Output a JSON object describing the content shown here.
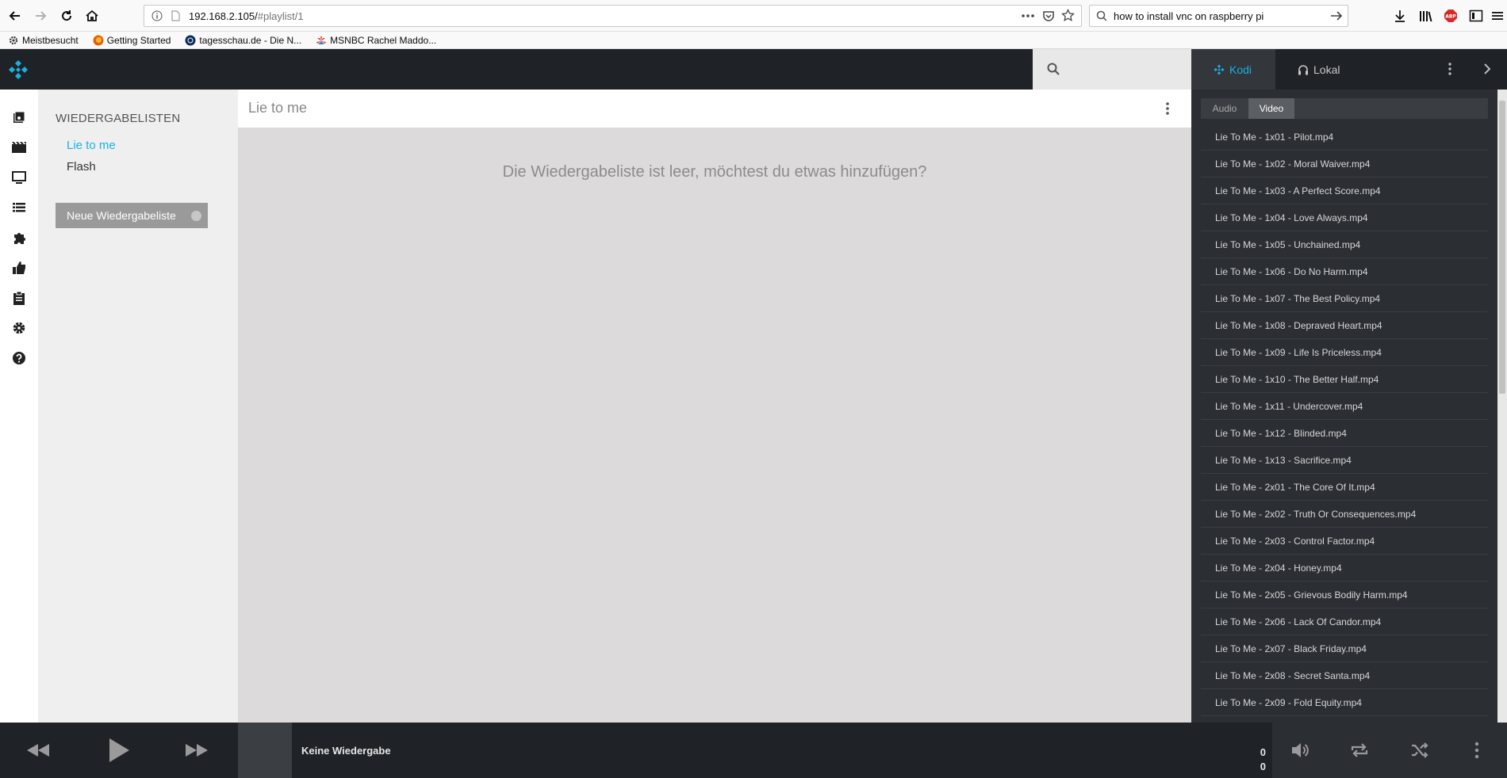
{
  "browser": {
    "url_host": "192.168.2.105/",
    "url_path": "#playlist/1",
    "search_text": "how to install vnc on raspberry pi",
    "bookmarks": [
      {
        "label": "Meistbesucht",
        "icon": "gear-icon"
      },
      {
        "label": "Getting Started",
        "icon": "firefox-icon"
      },
      {
        "label": "tagesschau.de - Die N...",
        "icon": "tagesschau-icon"
      },
      {
        "label": "MSNBC Rachel Maddo...",
        "icon": "msnbc-icon"
      }
    ]
  },
  "sidebar": {
    "heading": "WIEDERGABELISTEN",
    "playlists": [
      "Lie to me",
      "Flash"
    ],
    "active_index": 0,
    "new_playlist_label": "Neue Wiedergabeliste"
  },
  "main": {
    "title": "Lie to me",
    "empty_message": "Die Wiedergabeliste ist leer, möchtest du etwas hinzufügen?"
  },
  "right_panel": {
    "tabs": [
      "Kodi",
      "Lokal"
    ],
    "active_tab": "Kodi",
    "sub_tabs": [
      "Audio",
      "Video"
    ],
    "active_sub_tab": "Video",
    "files": [
      "Lie To Me - 1x01 - Pilot.mp4",
      "Lie To Me - 1x02 - Moral Waiver.mp4",
      "Lie To Me - 1x03 - A Perfect Score.mp4",
      "Lie To Me - 1x04 - Love Always.mp4",
      "Lie To Me - 1x05 - Unchained.mp4",
      "Lie To Me - 1x06 - Do No Harm.mp4",
      "Lie To Me - 1x07 - The Best Policy.mp4",
      "Lie To Me - 1x08 - Depraved Heart.mp4",
      "Lie To Me - 1x09 - Life Is Priceless.mp4",
      "Lie To Me - 1x10 - The Better Half.mp4",
      "Lie To Me - 1x11 - Undercover.mp4",
      "Lie To Me - 1x12 - Blinded.mp4",
      "Lie To Me - 1x13 - Sacrifice.mp4",
      "Lie To Me - 2x01 - The Core Of It.mp4",
      "Lie To Me - 2x02 - Truth Or Consequences.mp4",
      "Lie To Me - 2x03 - Control Factor.mp4",
      "Lie To Me - 2x04 - Honey.mp4",
      "Lie To Me - 2x05 - Grievous Bodily Harm.mp4",
      "Lie To Me - 2x06 - Lack Of Candor.mp4",
      "Lie To Me - 2x07 - Black Friday.mp4",
      "Lie To Me - 2x08 - Secret Santa.mp4",
      "Lie To Me - 2x09 - Fold Equity.mp4"
    ]
  },
  "player": {
    "now_playing": "Keine Wiedergabe",
    "time_top": "0",
    "time_bottom": "0"
  },
  "colors": {
    "accent": "#17b2e0",
    "header_bg": "#1f2226",
    "panel_bg": "#2b2e33"
  }
}
